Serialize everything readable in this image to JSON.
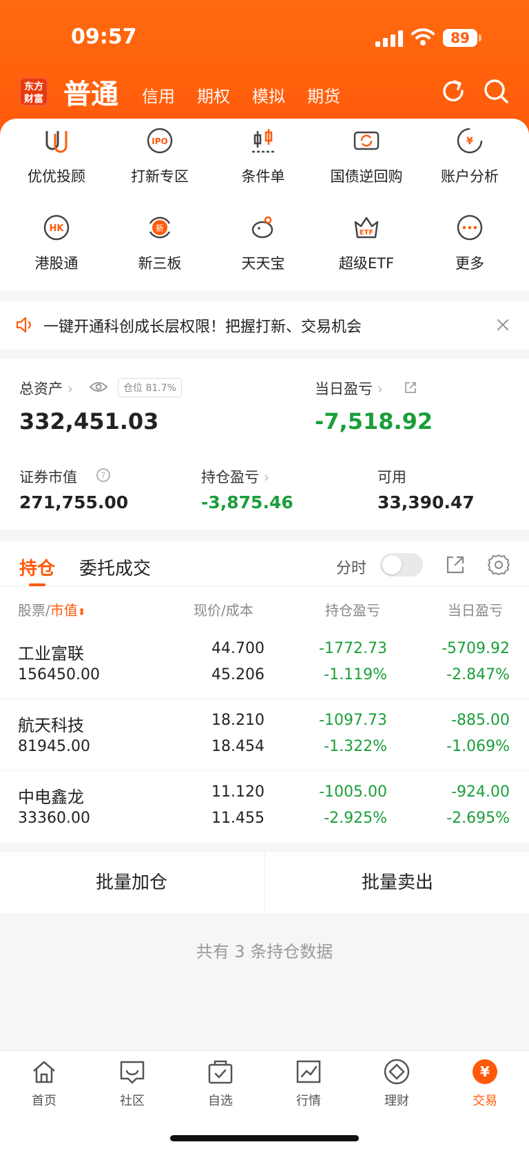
{
  "status": {
    "time": "09:57",
    "battery": "89"
  },
  "nav": {
    "logo": [
      "东方",
      "财富"
    ],
    "title": "普通",
    "tabs": [
      "信用",
      "期权",
      "模拟",
      "期货"
    ]
  },
  "features": [
    {
      "label": "优优投顾",
      "icon": "uu-advisor-icon"
    },
    {
      "label": "打新专区",
      "icon": "ipo-icon"
    },
    {
      "label": "条件单",
      "icon": "condition-order-icon"
    },
    {
      "label": "国债逆回购",
      "icon": "reverse-repo-icon"
    },
    {
      "label": "账户分析",
      "icon": "account-analysis-icon"
    },
    {
      "label": "港股通",
      "icon": "hk-icon"
    },
    {
      "label": "新三板",
      "icon": "new-third-board-icon"
    },
    {
      "label": "天天宝",
      "icon": "piggy-bank-icon"
    },
    {
      "label": "超级ETF",
      "icon": "etf-icon"
    },
    {
      "label": "更多",
      "icon": "more-icon"
    }
  ],
  "notice": {
    "text": "一键开通科创成长层权限！把握打新、交易机会"
  },
  "assets": {
    "total_label": "总资产",
    "position_chip": "仓位 81.7%",
    "total_value": "332,451.03",
    "daily_pl_label": "当日盈亏",
    "daily_pl_value": "-7,518.92",
    "market_value_label": "证券市值",
    "market_value": "271,755.00",
    "holding_pl_label": "持仓盈亏",
    "holding_pl_value": "-3,875.46",
    "available_label": "可用",
    "available_value": "33,390.47"
  },
  "holdings": {
    "tabs": [
      "持仓",
      "委托成交"
    ],
    "toggle_label": "分时",
    "headers": {
      "stock": "股票",
      "slash": "/",
      "mv": "市值",
      "price": "现价",
      "price_slash": "/",
      "cost": "成本",
      "holding_pl": "持仓盈亏",
      "daily_pl": "当日盈亏"
    },
    "rows": [
      {
        "name": "工业富联",
        "mv": "156450.00",
        "price": "44.700",
        "cost": "45.206",
        "hpl": "-1772.73",
        "hpl_pct": "-1.119%",
        "dpl": "-5709.92",
        "dpl_pct": "-2.847%"
      },
      {
        "name": "航天科技",
        "mv": "81945.00",
        "price": "18.210",
        "cost": "18.454",
        "hpl": "-1097.73",
        "hpl_pct": "-1.322%",
        "dpl": "-885.00",
        "dpl_pct": "-1.069%"
      },
      {
        "name": "中电鑫龙",
        "mv": "33360.00",
        "price": "11.120",
        "cost": "11.455",
        "hpl": "-1005.00",
        "hpl_pct": "-2.925%",
        "dpl": "-924.00",
        "dpl_pct": "-2.695%"
      }
    ]
  },
  "actions": {
    "batch_add": "批量加仓",
    "batch_sell": "批量卖出"
  },
  "footnote": "共有 3 条持仓数据",
  "tabbar": [
    {
      "label": "首页",
      "icon": "home-icon"
    },
    {
      "label": "社区",
      "icon": "community-icon"
    },
    {
      "label": "自选",
      "icon": "watchlist-icon"
    },
    {
      "label": "行情",
      "icon": "market-icon"
    },
    {
      "label": "理财",
      "icon": "wealth-icon"
    },
    {
      "label": "交易",
      "icon": "trade-icon"
    }
  ],
  "colors": {
    "accent": "#ff5a0a",
    "loss": "#1a9e3a"
  }
}
